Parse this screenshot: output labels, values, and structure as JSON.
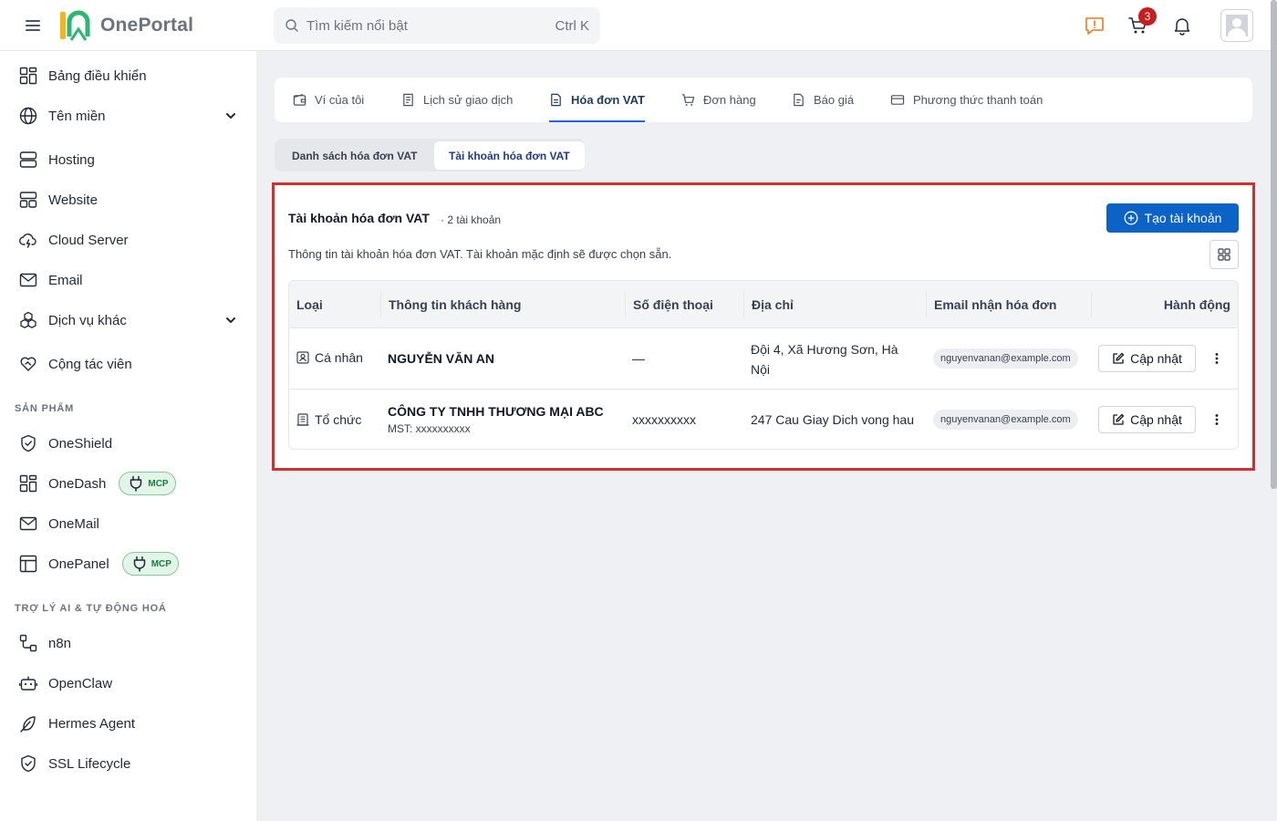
{
  "app": {
    "name": "OnePortal"
  },
  "search": {
    "placeholder": "Tìm kiếm nổi bật",
    "shortcut": "Ctrl K"
  },
  "header": {
    "cart_count": "3"
  },
  "sidebar": {
    "items": [
      {
        "label": "Bảng điều khiển"
      },
      {
        "label": "Tên miền"
      },
      {
        "label": "Hosting"
      },
      {
        "label": "Website"
      },
      {
        "label": "Cloud Server"
      },
      {
        "label": "Email"
      },
      {
        "label": "Dịch vụ khác"
      },
      {
        "label": "Cộng tác viên"
      }
    ],
    "section_products": "SẢN PHẨM",
    "products": [
      {
        "label": "OneShield"
      },
      {
        "label": "OneDash",
        "badge": "MCP"
      },
      {
        "label": "OneMail"
      },
      {
        "label": "OnePanel",
        "badge": "MCP"
      }
    ],
    "section_ai": "TRỢ LÝ AI & TỰ ĐỘNG HOÁ",
    "ai": [
      {
        "label": "n8n"
      },
      {
        "label": "OpenClaw"
      },
      {
        "label": "Hermes Agent"
      },
      {
        "label": "SSL Lifecycle"
      }
    ]
  },
  "tabs": [
    {
      "label": "Ví của tôi"
    },
    {
      "label": "Lịch sử giao dịch"
    },
    {
      "label": "Hóa đơn VAT"
    },
    {
      "label": "Đơn hàng"
    },
    {
      "label": "Báo giá"
    },
    {
      "label": "Phương thức thanh toán"
    }
  ],
  "subtabs": [
    {
      "label": "Danh sách hóa đơn VAT"
    },
    {
      "label": "Tài khoản hóa đơn VAT"
    }
  ],
  "panel": {
    "title": "Tài khoản hóa đơn VAT",
    "count": "· 2 tài khoản",
    "description": "Thông tin tài khoản hóa đơn VAT. Tài khoản mặc định sẽ được chọn sẵn.",
    "create_label": "Tạo tài khoản"
  },
  "table": {
    "columns": [
      "Loại",
      "Thông tin khách hàng",
      "Số điện thoại",
      "Địa chỉ",
      "Email nhận hóa đơn",
      "Hành động"
    ],
    "rows": [
      {
        "type": "Cá nhân",
        "name": "NGUYỄN VĂN AN",
        "phone": "—",
        "address": "Đội 4, Xã Hương Sơn, Hà Nội",
        "email": "nguyenvanan@example.com",
        "action": "Cập nhật"
      },
      {
        "type": "Tổ chức",
        "name": "CÔNG TY TNHH THƯƠNG MẠI ABC",
        "mst": "MST: xxxxxxxxxx",
        "phone": "xxxxxxxxxx",
        "address": "247 Cau Giay Dich vong hau",
        "email": "nguyenvanan@example.com",
        "action": "Cập nhật"
      }
    ]
  },
  "colors": {
    "primary": "#0b63c8",
    "highlight_border": "#d32f2f",
    "mcp_green": "#15803d",
    "badge_red": "#c81e1e"
  }
}
